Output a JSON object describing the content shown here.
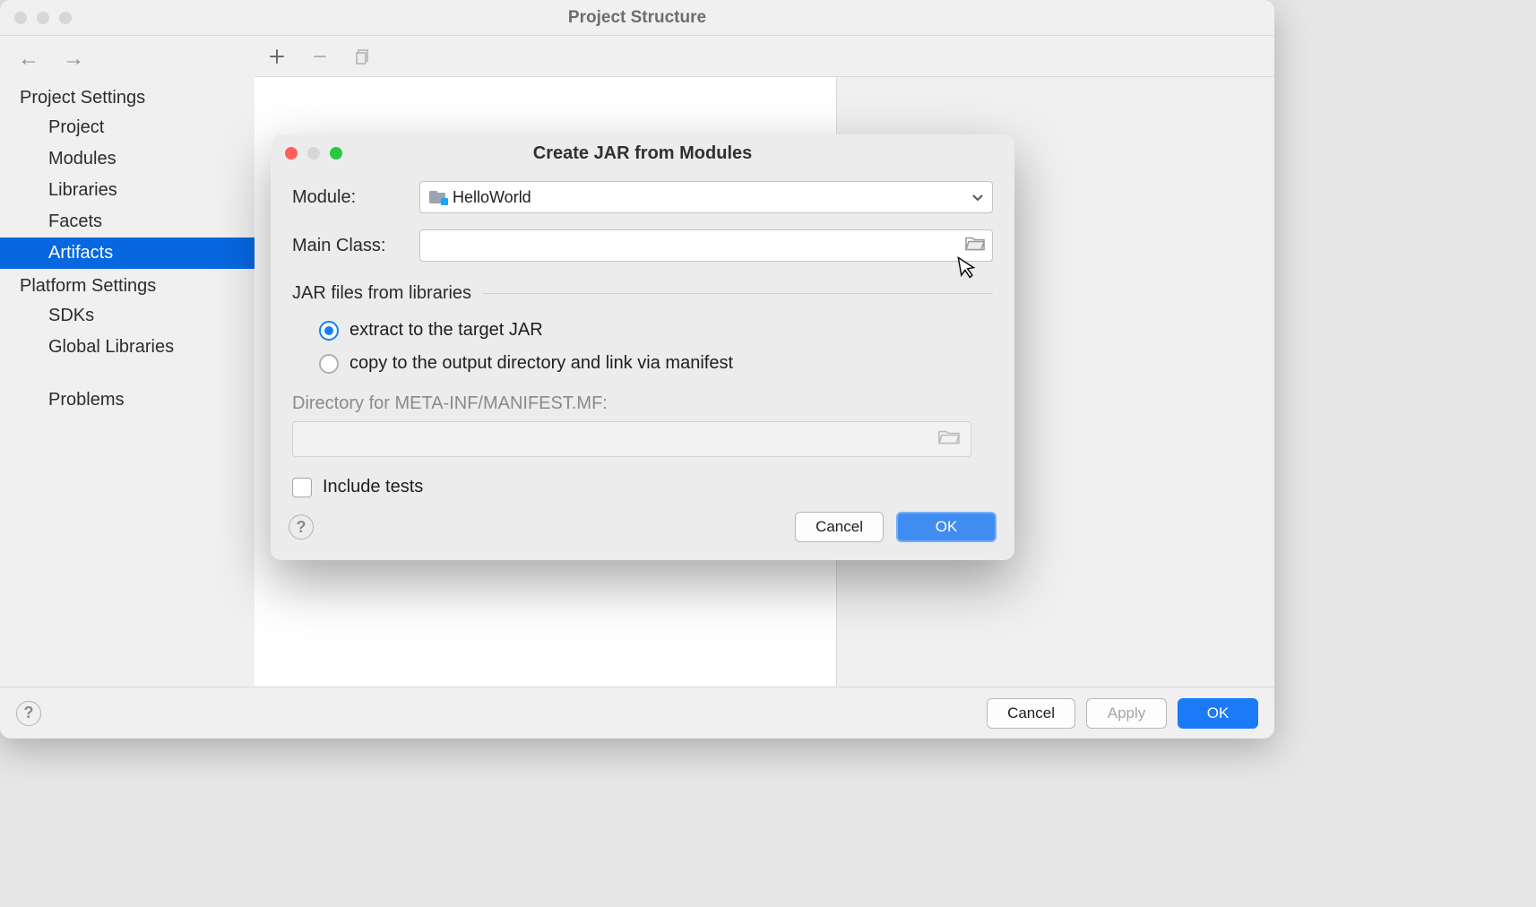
{
  "window": {
    "title": "Project Structure",
    "footer": {
      "cancel": "Cancel",
      "apply": "Apply",
      "ok": "OK"
    }
  },
  "sidebar": {
    "sections": [
      {
        "heading": "Project Settings",
        "items": [
          {
            "label": "Project",
            "selected": false
          },
          {
            "label": "Modules",
            "selected": false
          },
          {
            "label": "Libraries",
            "selected": false
          },
          {
            "label": "Facets",
            "selected": false
          },
          {
            "label": "Artifacts",
            "selected": true
          }
        ]
      },
      {
        "heading": "Platform Settings",
        "items": [
          {
            "label": "SDKs",
            "selected": false
          },
          {
            "label": "Global Libraries",
            "selected": false
          }
        ]
      }
    ],
    "problems_label": "Problems"
  },
  "dialog": {
    "title": "Create JAR from Modules",
    "module_label": "Module:",
    "module_value": "HelloWorld",
    "main_class_label": "Main Class:",
    "main_class_value": "",
    "section_label": "JAR files from libraries",
    "radio1": "extract to the target JAR",
    "radio2": "copy to the output directory and link via manifest",
    "meta_label": "Directory for META-INF/MANIFEST.MF:",
    "include_tests": "Include tests",
    "cancel": "Cancel",
    "ok": "OK"
  }
}
